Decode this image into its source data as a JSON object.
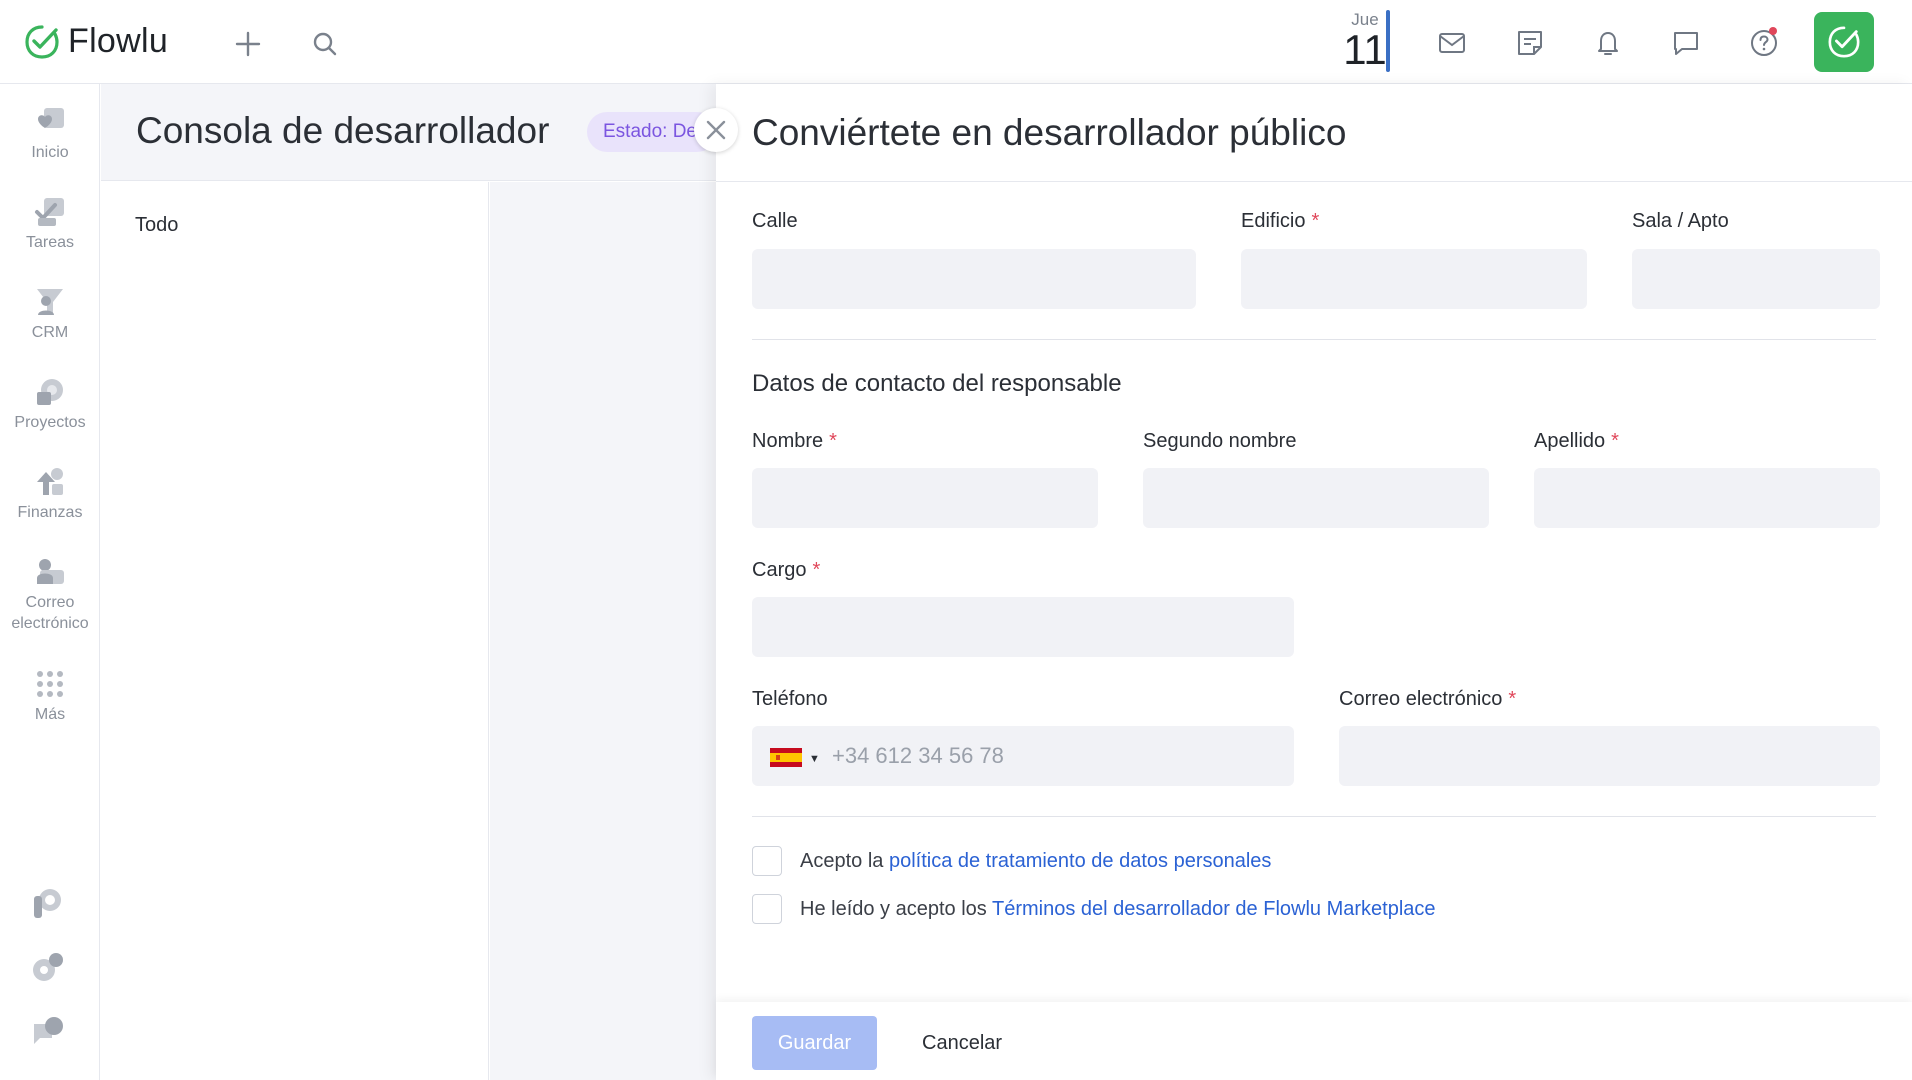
{
  "app": {
    "logo_text": "Flowlu",
    "brand_green": "#3ab45c",
    "date_day": "Jue",
    "date_num": "11"
  },
  "sidebar": {
    "items": [
      {
        "label": "Inicio",
        "icon": "heart-icon"
      },
      {
        "label": "Tareas",
        "icon": "tasks-icon"
      },
      {
        "label": "CRM",
        "icon": "crm-funnel-icon"
      },
      {
        "label": "Proyectos",
        "icon": "projects-icon"
      },
      {
        "label": "Finanzas",
        "icon": "finance-icon"
      },
      {
        "label": "Correo electrónico",
        "icon": "mail-icon"
      },
      {
        "label": "Más",
        "icon": "more-grid-icon"
      }
    ]
  },
  "page": {
    "title": "Consola de desarrollador",
    "status": "Estado: De",
    "filter_all": "Todo"
  },
  "panel": {
    "title": "Conviértete en desarrollador público",
    "street_label": "Calle",
    "building_label": "Edificio",
    "room_label": "Sala / Apto",
    "contact_section": "Datos de contacto del responsable",
    "first_name_label": "Nombre",
    "middle_name_label": "Segundo nombre",
    "last_name_label": "Apellido",
    "position_label": "Cargo",
    "phone_label": "Teléfono",
    "phone_placeholder": "+34 612 34 56 78",
    "email_label": "Correo electrónico",
    "required_mark": "*",
    "consent1_prefix": "Acepto la ",
    "consent1_link": "política de tratamiento de datos personales",
    "consent2_prefix": "He leído y acepto los ",
    "consent2_link": "Términos del desarrollador de Flowlu Marketplace",
    "save_label": "Guardar",
    "cancel_label": "Cancelar"
  }
}
